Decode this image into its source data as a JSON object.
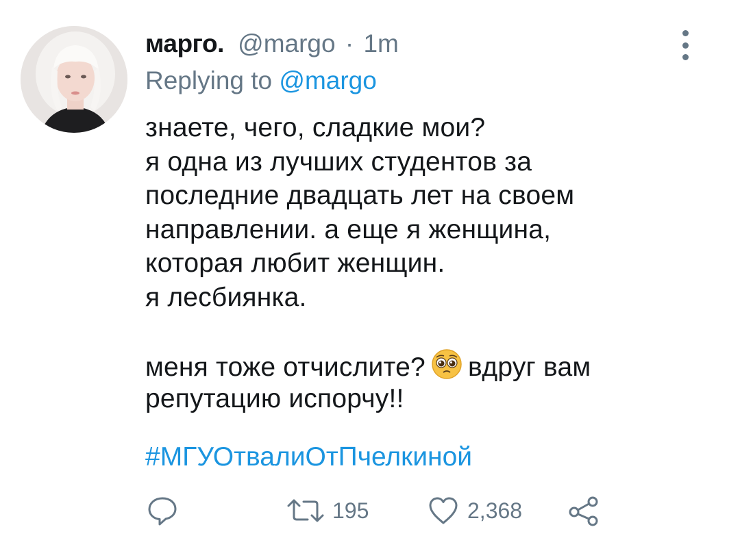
{
  "tweet": {
    "author_name": "марго.",
    "handle": "@margo",
    "separator": "·",
    "time": "1m",
    "replying_prefix": "Replying to",
    "replying_to": "@margo",
    "body_lines": [
      "знаете, чего, сладкие мои?",
      "я одна из лучших студентов за",
      "последние двадцать лет на своем",
      "направлении. а еще я женщина,",
      "которая любит женщин.",
      "я лесбиянка."
    ],
    "body_line_7_before_emoji": "меня тоже отчислите?",
    "emoji": "pleading-face",
    "body_line_7_after_emoji": "вдруг вам",
    "body_line_8": "репутацию испорчу!!",
    "hashtag": "#МГУОтвалиОтПчелкиной",
    "retweet_count": "195",
    "like_count": "2,368"
  },
  "colors": {
    "text": "#14171a",
    "muted": "#657786",
    "link": "#1b95e0"
  },
  "icons": [
    "reply-icon",
    "retweet-icon",
    "like-icon",
    "share-icon",
    "more-options-icon"
  ]
}
